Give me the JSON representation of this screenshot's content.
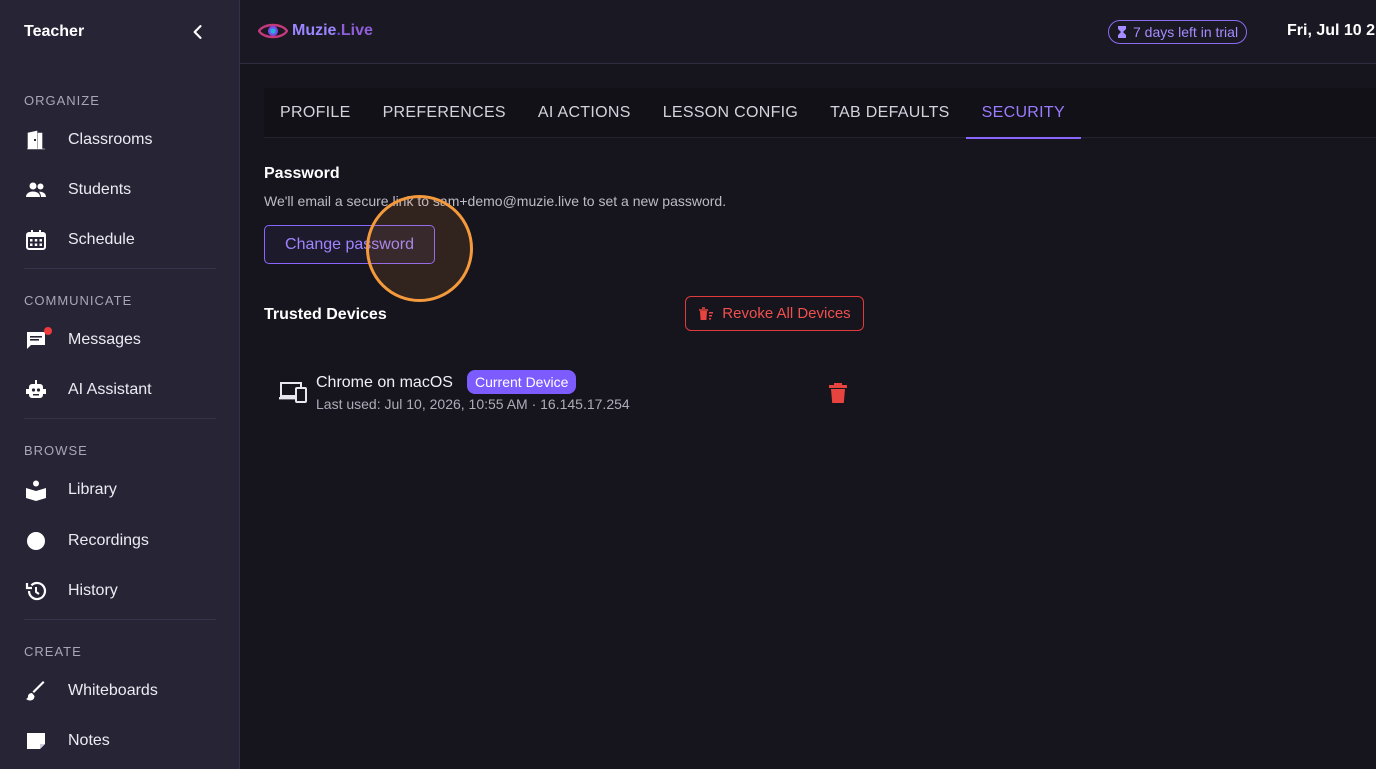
{
  "sidebar": {
    "title": "Teacher",
    "sections": [
      {
        "label": "ORGANIZE",
        "items": [
          {
            "label": "Classrooms",
            "icon": "classroom-icon"
          },
          {
            "label": "Students",
            "icon": "people-icon"
          },
          {
            "label": "Schedule",
            "icon": "calendar-icon"
          }
        ]
      },
      {
        "label": "COMMUNICATE",
        "items": [
          {
            "label": "Messages",
            "icon": "message-icon"
          },
          {
            "label": "AI Assistant",
            "icon": "robot-icon"
          }
        ]
      },
      {
        "label": "BROWSE",
        "items": [
          {
            "label": "Library",
            "icon": "library-icon"
          },
          {
            "label": "Recordings",
            "icon": "record-icon"
          },
          {
            "label": "History",
            "icon": "history-icon"
          }
        ]
      },
      {
        "label": "CREATE",
        "items": [
          {
            "label": "Whiteboards",
            "icon": "brush-icon"
          },
          {
            "label": "Notes",
            "icon": "note-icon"
          }
        ]
      }
    ]
  },
  "header": {
    "brand": "Muzie.Live",
    "trial": "7 days left in trial",
    "date": "Fri, Jul 10 2"
  },
  "tabs": [
    {
      "label": "PROFILE",
      "active": false
    },
    {
      "label": "PREFERENCES",
      "active": false
    },
    {
      "label": "AI ACTIONS",
      "active": false
    },
    {
      "label": "LESSON CONFIG",
      "active": false
    },
    {
      "label": "TAB DEFAULTS",
      "active": false
    },
    {
      "label": "SECURITY",
      "active": true
    }
  ],
  "password": {
    "title": "Password",
    "description": "We'll email a secure link to sam+demo@muzie.live to set a new password.",
    "button": "Change password"
  },
  "trusted_devices": {
    "title": "Trusted Devices",
    "revoke_all": "Revoke All Devices",
    "devices": [
      {
        "name": "Chrome on macOS",
        "badge": "Current Device",
        "meta": "Last used: Jul 10, 2026, 10:55 AM · 16.145.17.254"
      }
    ]
  },
  "colors": {
    "accent": "#8a66ff",
    "danger": "#e03a3a",
    "sidebar_bg": "#272436",
    "page_bg": "#16141c"
  }
}
